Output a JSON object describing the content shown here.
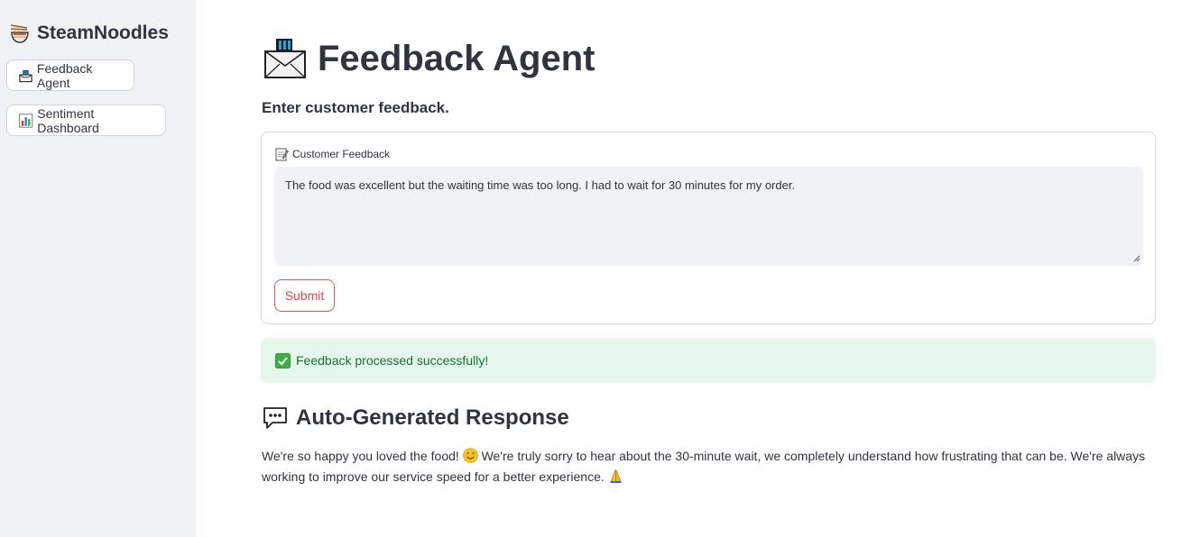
{
  "sidebar": {
    "brand": "SteamNoodles",
    "brand_icon": "noodle-bowl-icon",
    "items": [
      {
        "label": "Feedback Agent",
        "icon": "inbox-tray-icon"
      },
      {
        "label": "Sentiment Dashboard",
        "icon": "bar-chart-icon"
      }
    ]
  },
  "main": {
    "title": "Feedback Agent",
    "title_icon": "envelope-inbox-icon",
    "subtitle": "Enter customer feedback.",
    "form": {
      "field_label": "Customer Feedback",
      "field_icon": "memo-icon",
      "field_value": "The food was excellent but the waiting time was too long. I had to wait for 30 minutes for my order.",
      "submit_label": "Submit"
    },
    "success_message": "Feedback processed successfully!",
    "success_icon": "check-mark-icon",
    "response_heading": "Auto-Generated Response",
    "response_icon": "speech-bubble-icon",
    "response_part1": "We're so happy you loved the food!",
    "response_part2": "We're truly sorry to hear about the 30-minute wait, we completely understand how frustrating that can be. We're always working to improve our service speed for a better experience.",
    "colors": {
      "accent": "#e04848",
      "sidebar_bg": "#f0f2f6",
      "success_bg": "#e4f7ea",
      "success_text": "#177233"
    }
  }
}
